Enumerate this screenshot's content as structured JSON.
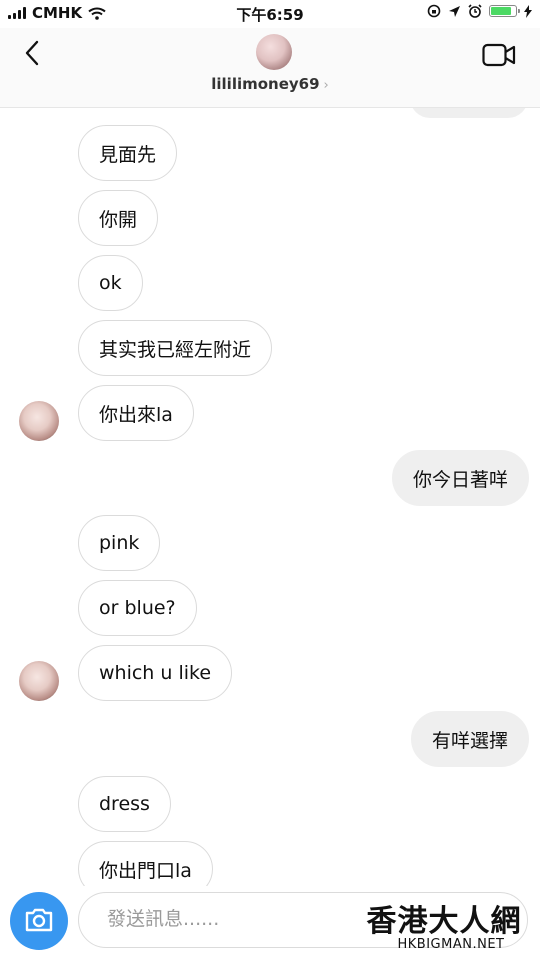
{
  "status_bar": {
    "carrier": "CMHK",
    "time": "下午6:59"
  },
  "header": {
    "username": "lililimoney69",
    "chevron": "›"
  },
  "messages": [
    {
      "side": "in",
      "text": "見面先"
    },
    {
      "side": "in",
      "text": "你開"
    },
    {
      "side": "in",
      "text": "ok"
    },
    {
      "side": "in",
      "text": "其实我已經左附近"
    },
    {
      "side": "in",
      "text": "你出來la"
    },
    {
      "side": "out",
      "text": "你今日著咩"
    },
    {
      "side": "in",
      "text": "pink"
    },
    {
      "side": "in",
      "text": "or blue?"
    },
    {
      "side": "in",
      "text": "which u like"
    },
    {
      "side": "out",
      "text": "有咩選擇"
    },
    {
      "side": "in",
      "text": "dress"
    },
    {
      "side": "in",
      "text": "你出門口la"
    }
  ],
  "composer": {
    "placeholder": "發送訊息......"
  },
  "watermark": {
    "main": "香港大人網",
    "sub": "HKBIGMAN.NET"
  },
  "colors": {
    "accent": "#3897f0",
    "battery": "#4cd964",
    "bubble_out": "#efefef",
    "bubble_border": "#dbdbdb"
  },
  "icons": [
    "signal-icon",
    "wifi-icon",
    "lock-rotation-icon",
    "location-icon",
    "alarm-icon",
    "battery-icon",
    "charging-icon",
    "back-icon",
    "video-call-icon",
    "camera-icon"
  ]
}
